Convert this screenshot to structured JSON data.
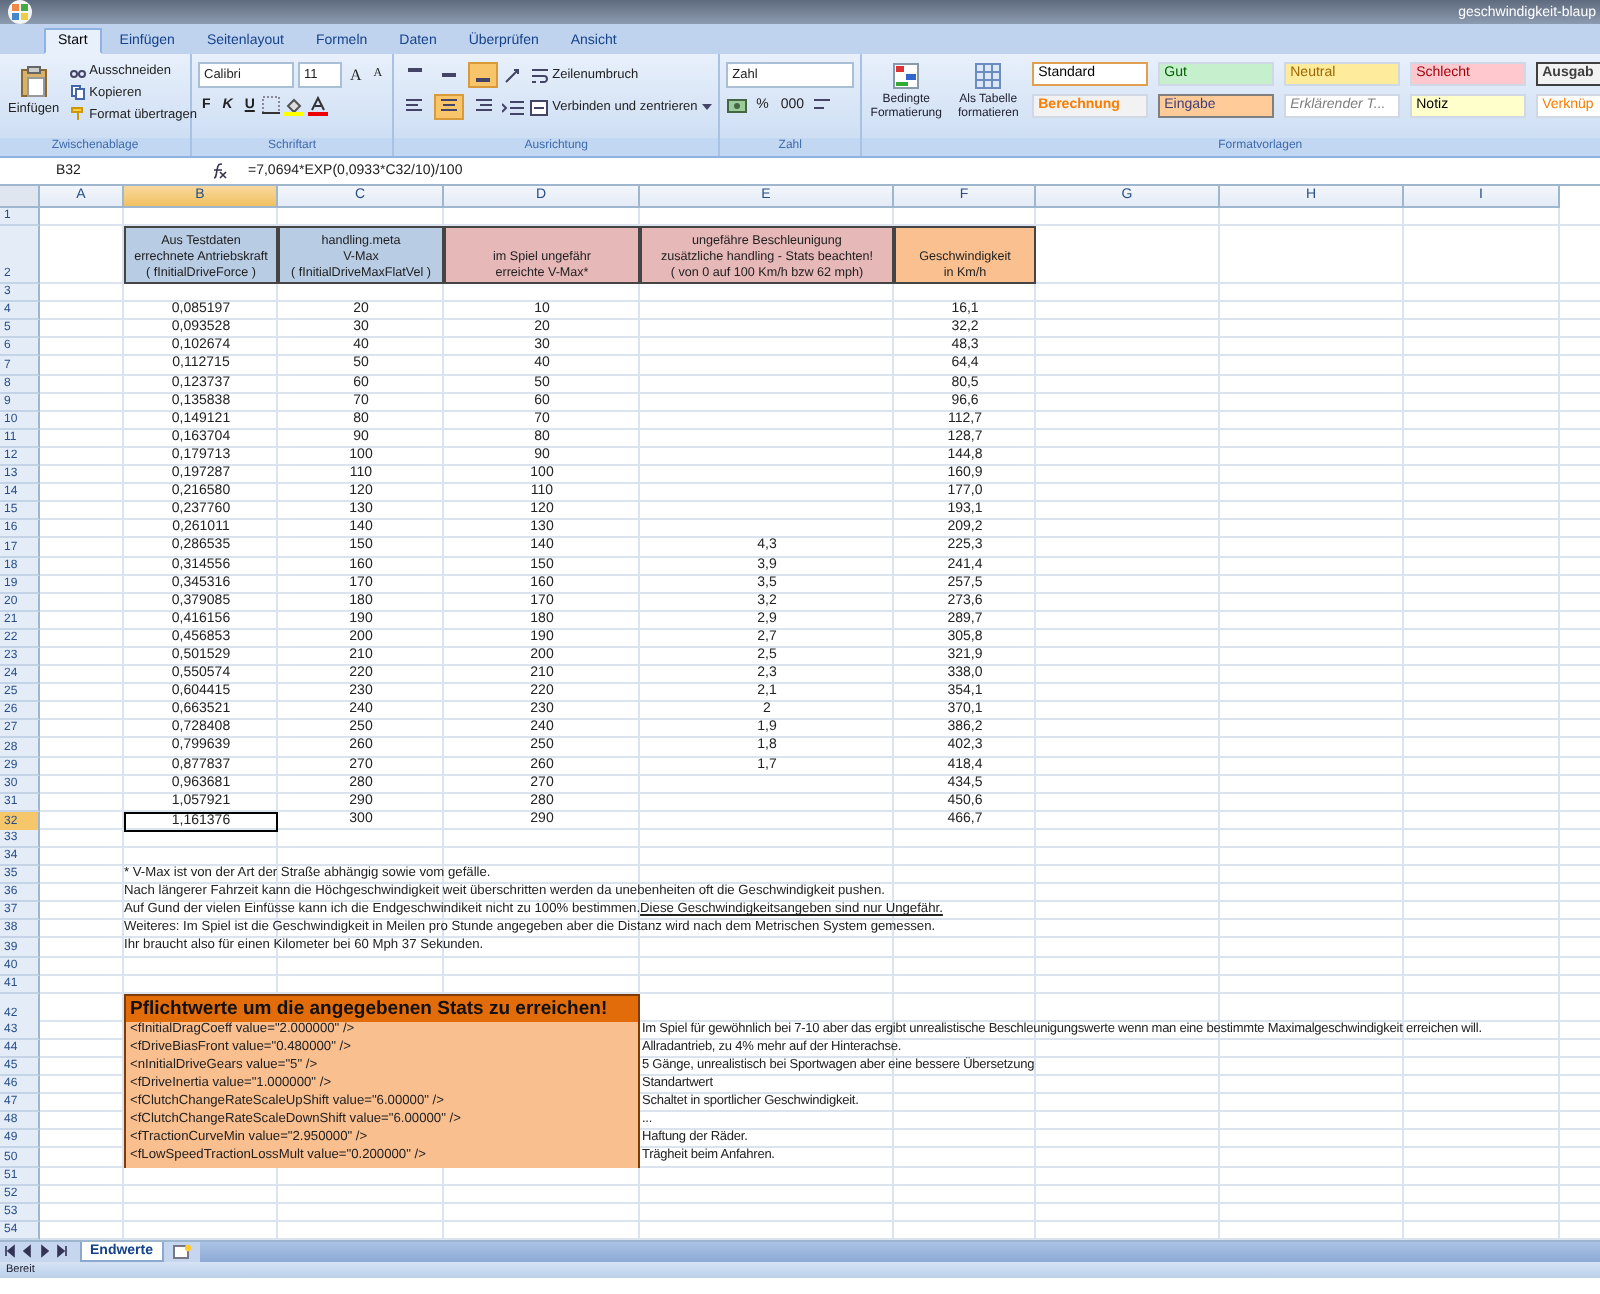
{
  "window": {
    "title": "geschwindigkeit-blaup"
  },
  "ribbon": {
    "tabs": [
      {
        "label": "Start",
        "selected": true
      },
      {
        "label": "Einfügen",
        "selected": false
      },
      {
        "label": "Seitenlayout",
        "selected": false
      },
      {
        "label": "Formeln",
        "selected": false
      },
      {
        "label": "Daten",
        "selected": false
      },
      {
        "label": "Überprüfen",
        "selected": false
      },
      {
        "label": "Ansicht",
        "selected": false
      }
    ],
    "clipboard": {
      "label": "Zwischenablage",
      "paste": "Einfügen",
      "actions": [
        "Ausschneiden",
        "Kopieren",
        "Format übertragen"
      ]
    },
    "font": {
      "label": "Schriftart",
      "family": "Calibri",
      "size": "11",
      "grow": "A",
      "shrink": "A",
      "styles": [
        "F",
        "K",
        "U"
      ]
    },
    "alignment": {
      "label": "Ausrichtung",
      "wrap": "Zeilenumbruch",
      "merge": "Verbinden und zentrieren",
      "valign": [
        {
          "selected": false
        },
        {
          "selected": false
        },
        {
          "selected": true
        }
      ],
      "halign": [
        {
          "selected": false
        },
        {
          "selected": true
        },
        {
          "selected": false
        }
      ]
    },
    "number": {
      "label": "Zahl",
      "format": "Zahl",
      "percent": "%",
      "thousands": "000"
    },
    "styles": {
      "label": "Formatvorlagen",
      "conditional": "Bedingte Formatierung",
      "as_table": "Als Tabelle formatieren",
      "gallery": [
        {
          "label": "Standard",
          "kind": "standard"
        },
        {
          "label": "Gut",
          "kind": "good"
        },
        {
          "label": "Neutral",
          "kind": "neutral"
        },
        {
          "label": "Schlecht",
          "kind": "bad"
        },
        {
          "label": "Ausgab",
          "kind": "output"
        },
        {
          "label": "Berechnung",
          "kind": "calculation"
        },
        {
          "label": "Eingabe",
          "kind": "input"
        },
        {
          "label": "Erklärender T...",
          "kind": "explanatory"
        },
        {
          "label": "Notiz",
          "kind": "note"
        },
        {
          "label": "Verknüp",
          "kind": "linked"
        }
      ]
    }
  },
  "formula_bar": {
    "cell": "B32",
    "formula": "=7,0694*EXP(0,0933*C32/10)/100"
  },
  "columns": [
    {
      "label": "A",
      "selected": false
    },
    {
      "label": "B",
      "selected": true
    },
    {
      "label": "C",
      "selected": false
    },
    {
      "label": "D",
      "selected": false
    },
    {
      "label": "E",
      "selected": false
    },
    {
      "label": "F",
      "selected": false
    },
    {
      "label": "G",
      "selected": false
    },
    {
      "label": "H",
      "selected": false
    },
    {
      "label": "I",
      "selected": false
    }
  ],
  "rows": [
    {
      "number": "1",
      "kind": "blank"
    },
    {
      "number": "2",
      "kind": "header",
      "cells": [
        {
          "text": "Aus Testdaten\nerrechnete Antriebskraft\n( fInitialDriveForce )",
          "color": "#b8cce4"
        },
        {
          "text": "handling.meta\nV-Max\n( fInitialDriveMaxFlatVel )",
          "color": "#b8cce4"
        },
        {
          "text": "im Spiel ungefähr\nerreichte V-Max*",
          "color": "#e6b8b7"
        },
        {
          "text": "ungefähre Beschleunigung\nzusätzliche handling - Stats beachten!\n( von 0 auf 100 Km/h  bzw 62 mph)",
          "color": "#e6b8b7"
        },
        {
          "text": "Geschwindigkeit\nin Km/h",
          "color": "#fac090"
        }
      ]
    },
    {
      "number": "3",
      "kind": "blank"
    },
    {
      "number": "4",
      "kind": "data",
      "selected": false,
      "force": "0,085197",
      "vmax": "20",
      "reached": "10",
      "kmh": "16,1"
    },
    {
      "number": "5",
      "kind": "data",
      "selected": false,
      "force": "0,093528",
      "vmax": "30",
      "reached": "20",
      "kmh": "32,2"
    },
    {
      "number": "6",
      "kind": "data",
      "selected": false,
      "force": "0,102674",
      "vmax": "40",
      "reached": "30",
      "kmh": "48,3"
    },
    {
      "number": "7",
      "kind": "data",
      "selected": false,
      "force": "0,112715",
      "vmax": "50",
      "reached": "40",
      "kmh": "64,4"
    },
    {
      "number": "8",
      "kind": "data",
      "selected": false,
      "force": "0,123737",
      "vmax": "60",
      "reached": "50",
      "kmh": "80,5"
    },
    {
      "number": "9",
      "kind": "data",
      "selected": false,
      "force": "0,135838",
      "vmax": "70",
      "reached": "60",
      "kmh": "96,6"
    },
    {
      "number": "10",
      "kind": "data",
      "selected": false,
      "force": "0,149121",
      "vmax": "80",
      "reached": "70",
      "kmh": "112,7"
    },
    {
      "number": "11",
      "kind": "data",
      "selected": false,
      "force": "0,163704",
      "vmax": "90",
      "reached": "80",
      "kmh": "128,7"
    },
    {
      "number": "12",
      "kind": "data",
      "selected": false,
      "force": "0,179713",
      "vmax": "100",
      "reached": "90",
      "kmh": "144,8"
    },
    {
      "number": "13",
      "kind": "data",
      "selected": false,
      "force": "0,197287",
      "vmax": "110",
      "reached": "100",
      "kmh": "160,9"
    },
    {
      "number": "14",
      "kind": "data",
      "selected": false,
      "force": "0,216580",
      "vmax": "120",
      "reached": "110",
      "kmh": "177,0"
    },
    {
      "number": "15",
      "kind": "data",
      "selected": false,
      "force": "0,237760",
      "vmax": "130",
      "reached": "120",
      "kmh": "193,1"
    },
    {
      "number": "16",
      "kind": "data",
      "selected": false,
      "force": "0,261011",
      "vmax": "140",
      "reached": "130",
      "kmh": "209,2"
    },
    {
      "number": "17",
      "kind": "data",
      "selected": false,
      "force": "0,286535",
      "vmax": "150",
      "reached": "140",
      "accel": "4,3",
      "kmh": "225,3"
    },
    {
      "number": "18",
      "kind": "data",
      "selected": false,
      "force": "0,314556",
      "vmax": "160",
      "reached": "150",
      "accel": "3,9",
      "kmh": "241,4"
    },
    {
      "number": "19",
      "kind": "data",
      "selected": false,
      "force": "0,345316",
      "vmax": "170",
      "reached": "160",
      "accel": "3,5",
      "kmh": "257,5"
    },
    {
      "number": "20",
      "kind": "data",
      "selected": false,
      "force": "0,379085",
      "vmax": "180",
      "reached": "170",
      "accel": "3,2",
      "kmh": "273,6"
    },
    {
      "number": "21",
      "kind": "data",
      "selected": false,
      "force": "0,416156",
      "vmax": "190",
      "reached": "180",
      "accel": "2,9",
      "kmh": "289,7"
    },
    {
      "number": "22",
      "kind": "data",
      "selected": false,
      "force": "0,456853",
      "vmax": "200",
      "reached": "190",
      "accel": "2,7",
      "kmh": "305,8"
    },
    {
      "number": "23",
      "kind": "data",
      "selected": false,
      "force": "0,501529",
      "vmax": "210",
      "reached": "200",
      "accel": "2,5",
      "kmh": "321,9"
    },
    {
      "number": "24",
      "kind": "data",
      "selected": false,
      "force": "0,550574",
      "vmax": "220",
      "reached": "210",
      "accel": "2,3",
      "kmh": "338,0"
    },
    {
      "number": "25",
      "kind": "data",
      "selected": false,
      "force": "0,604415",
      "vmax": "230",
      "reached": "220",
      "accel": "2,1",
      "kmh": "354,1"
    },
    {
      "number": "26",
      "kind": "data",
      "selected": false,
      "force": "0,663521",
      "vmax": "240",
      "reached": "230",
      "accel": "2",
      "kmh": "370,1"
    },
    {
      "number": "27",
      "kind": "data",
      "selected": false,
      "force": "0,728408",
      "vmax": "250",
      "reached": "240",
      "accel": "1,9",
      "kmh": "386,2"
    },
    {
      "number": "28",
      "kind": "data",
      "selected": false,
      "force": "0,799639",
      "vmax": "260",
      "reached": "250",
      "accel": "1,8",
      "kmh": "402,3"
    },
    {
      "number": "29",
      "kind": "data",
      "selected": false,
      "force": "0,877837",
      "vmax": "270",
      "reached": "260",
      "accel": "1,7",
      "kmh": "418,4"
    },
    {
      "number": "30",
      "kind": "data",
      "selected": false,
      "force": "0,963681",
      "vmax": "280",
      "reached": "270",
      "kmh": "434,5"
    },
    {
      "number": "31",
      "kind": "data",
      "selected": false,
      "force": "1,057921",
      "vmax": "290",
      "reached": "280",
      "kmh": "450,6"
    },
    {
      "number": "32",
      "kind": "data",
      "selected": true,
      "force": "1,161376",
      "vmax": "300",
      "reached": "290",
      "kmh": "466,7"
    },
    {
      "number": "33",
      "kind": "blank"
    },
    {
      "number": "34",
      "kind": "blank"
    },
    {
      "number": "35",
      "kind": "note",
      "text": "* V-Max ist von der Art der Straße abhängig sowie vom gefälle."
    },
    {
      "number": "36",
      "kind": "note",
      "text": "Nach längerer Fahrzeit kann die Höchgeschwindigkeit weit überschritten werden da unebenheiten oft die Geschwindigkeit pushen."
    },
    {
      "number": "37",
      "kind": "note",
      "text": "Auf Gund der vielen Einfüsse kann ich die Endgeschwindikeit nicht zu 100% bestimmen.",
      "underlined": "Diese Geschwindigkeitsangeben sind nur Ungefähr."
    },
    {
      "number": "38",
      "kind": "note",
      "text": "Weiteres: Im Spiel ist die Geschwindigkeit in Meilen pro Stunde angegeben aber die Distanz wird nach dem Metrischen System gemessen."
    },
    {
      "number": "39",
      "kind": "note",
      "text": "Ihr braucht also für einen Kilometer bei 60 Mph 37 Sekunden."
    },
    {
      "number": "40",
      "kind": "blank"
    },
    {
      "number": "41",
      "kind": "blank"
    },
    {
      "number": "42",
      "kind": "title",
      "text": "Pflichtwerte um die angegebenen Stats zu erreichen!"
    },
    {
      "number": "43",
      "kind": "setting",
      "code": "<fInitialDragCoeff value=\"2.000000\" />",
      "comment": "Im Spiel für gewöhnlich bei 7-10 aber das ergibt unrealistische Beschleunigungswerte wenn man eine bestimmte Maximalgeschwindigkeit erreichen will."
    },
    {
      "number": "44",
      "kind": "setting",
      "code": "<fDriveBiasFront value=\"0.480000\" />",
      "comment": "Allradantrieb, zu 4% mehr auf der Hinterachse."
    },
    {
      "number": "45",
      "kind": "setting",
      "code": "<nInitialDriveGears value=\"5\" />",
      "comment": "5 Gänge, unrealistisch bei Sportwagen aber eine bessere Übersetzung"
    },
    {
      "number": "46",
      "kind": "setting",
      "code": "<fDriveInertia value=\"1.000000\" />",
      "comment": "Standartwert"
    },
    {
      "number": "47",
      "kind": "setting",
      "code": "<fClutchChangeRateScaleUpShift value=\"6.00000\" />",
      "comment": "Schaltet in sportlicher Geschwindigkeit."
    },
    {
      "number": "48",
      "kind": "setting",
      "code": "<fClutchChangeRateScaleDownShift value=\"6.00000\" />",
      "comment": "..."
    },
    {
      "number": "49",
      "kind": "setting",
      "code": "<fTractionCurveMin value=\"2.950000\" />",
      "comment": "Haftung der Räder."
    },
    {
      "number": "50",
      "kind": "setting",
      "code": "<fLowSpeedTractionLossMult value=\"0.200000\" />",
      "comment": "Trägheit beim Anfahren."
    },
    {
      "number": "51",
      "kind": "blank"
    },
    {
      "number": "52",
      "kind": "blank"
    },
    {
      "number": "53",
      "kind": "blank"
    },
    {
      "number": "54",
      "kind": "blank"
    }
  ],
  "sheet_tabs": [
    {
      "label": "Endwerte",
      "selected": true
    }
  ],
  "status_bar": {
    "text": "Bereit"
  }
}
